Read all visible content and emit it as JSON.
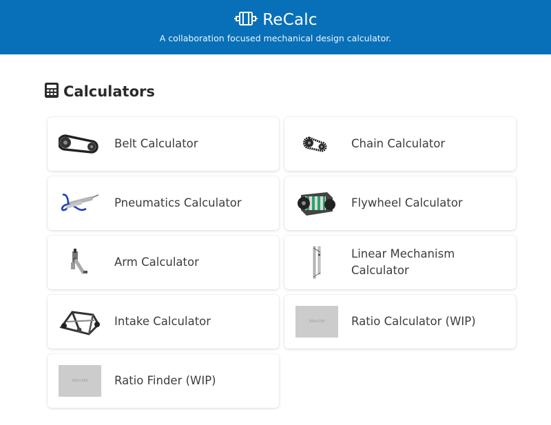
{
  "header": {
    "title": "ReCalc",
    "subtitle": "A collaboration focused mechanical design calculator.",
    "logo_icon": "motor-icon"
  },
  "section": {
    "title": "Calculators",
    "icon": "calculator-icon"
  },
  "calculators": [
    {
      "label": "Belt Calculator",
      "icon": "belt-icon"
    },
    {
      "label": "Chain Calculator",
      "icon": "chain-icon"
    },
    {
      "label": "Pneumatics Calculator",
      "icon": "pneumatic-cylinder-icon"
    },
    {
      "label": "Flywheel Calculator",
      "icon": "flywheel-icon"
    },
    {
      "label": "Arm Calculator",
      "icon": "arm-icon"
    },
    {
      "label": "Linear Mechanism Calculator",
      "icon": "linear-mechanism-icon"
    },
    {
      "label": "Intake Calculator",
      "icon": "intake-icon"
    },
    {
      "label": "Ratio Calculator (WIP)",
      "icon": "placeholder-image",
      "placeholder_text": "300×160"
    },
    {
      "label": "Ratio Finder (WIP)",
      "icon": "placeholder-image",
      "placeholder_text": "300×160"
    }
  ],
  "colors": {
    "header_bg": "#0870b8",
    "header_text": "#ffffff",
    "placeholder_bg": "#cccccc"
  }
}
